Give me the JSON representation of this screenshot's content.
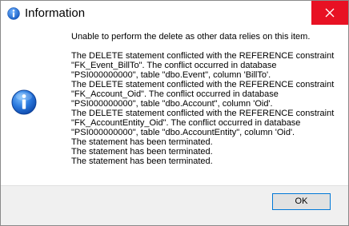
{
  "window": {
    "title": "Information",
    "icon": "info-icon",
    "close_icon": "close-icon"
  },
  "message": {
    "intro": "Unable to perform the delete as other data relies on this item.",
    "details": [
      "The DELETE statement conflicted with the REFERENCE constraint",
      "\"FK_Event_BillTo\". The conflict occurred in database",
      "\"PSI000000000\", table \"dbo.Event\", column 'BillTo'.",
      "The DELETE statement conflicted with the REFERENCE constraint",
      "\"FK_Account_Oid\". The conflict occurred in database",
      "\"PSI000000000\", table \"dbo.Account\", column 'Oid'.",
      "The DELETE statement conflicted with the REFERENCE constraint",
      "\"FK_AccountEntity_Oid\". The conflict occurred in database",
      "\"PSI000000000\", table \"dbo.AccountEntity\", column 'Oid'.",
      "The statement has been terminated.",
      "The statement has been terminated.",
      "The statement has been terminated."
    ]
  },
  "buttons": {
    "ok_label": "OK"
  },
  "colors": {
    "close_bg": "#e81123",
    "info_blue": "#1a63c6",
    "footer_bg": "#f0f0f0",
    "button_border": "#0078d7"
  }
}
